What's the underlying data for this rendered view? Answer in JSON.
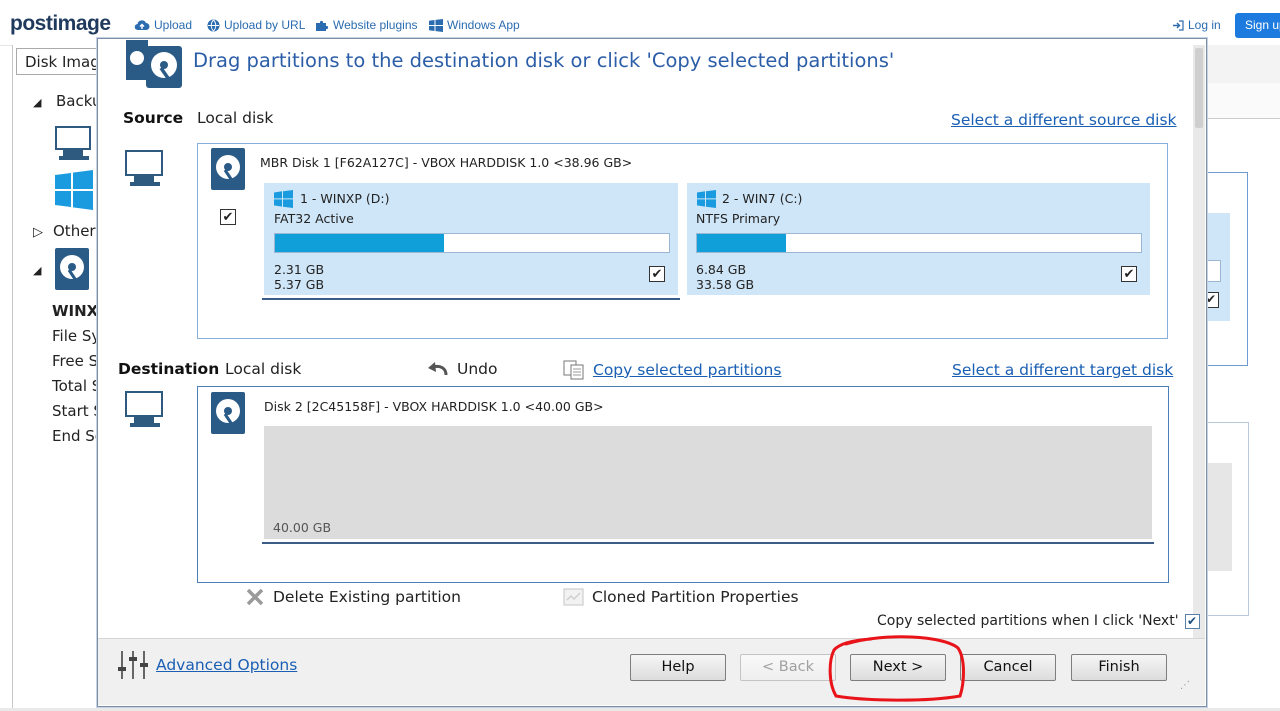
{
  "site": {
    "logo": "postimage",
    "nav": [
      {
        "label": "Upload",
        "icon": "cloud-upload-icon"
      },
      {
        "label": "Upload by URL",
        "icon": "globe-icon"
      },
      {
        "label": "Website plugins",
        "icon": "puzzle-icon"
      },
      {
        "label": "Windows App",
        "icon": "windows-icon"
      }
    ],
    "login": "Log in",
    "signup": "Sign up"
  },
  "background_app": {
    "tab": "Disk Image",
    "tree": [
      "Backu",
      "Other",
      "WINX",
      "File Sy",
      "Free Sp",
      "Total S",
      "Start S",
      "End Se"
    ]
  },
  "dialog": {
    "title": "Drag partitions to the destination disk or click 'Copy selected partitions'",
    "source": {
      "label": "Source",
      "type": "Local disk",
      "change_link": "Select a different source disk",
      "disk_title": "MBR Disk 1 [F62A127C] - VBOX HARDDISK 1.0  <38.96 GB>",
      "partitions": [
        {
          "name": "1 - WINXP (D:)",
          "fs": "FAT32 Active",
          "used": "2.31 GB",
          "total": "5.37 GB",
          "fill": 0.43,
          "checked": true
        },
        {
          "name": "2 - WIN7 (C:)",
          "fs": "NTFS Primary",
          "used": "6.84 GB",
          "total": "33.58 GB",
          "fill": 0.2,
          "checked": true
        }
      ]
    },
    "destination": {
      "label": "Destination",
      "type": "Local disk",
      "undo": "Undo",
      "copy_link": "Copy selected partitions",
      "change_link": "Select a different target disk",
      "disk_title": "Disk 2 [2C45158F] - VBOX HARDDISK 1.0  <40.00 GB>",
      "unallocated": "40.00 GB"
    },
    "actions": {
      "delete": "Delete Existing partition",
      "properties": "Cloned Partition Properties",
      "copy_on_next": "Copy selected partitions when I click 'Next'"
    },
    "footer": {
      "advanced": "Advanced Options",
      "help": "Help",
      "back": "< Back",
      "next": "Next >",
      "cancel": "Cancel",
      "finish": "Finish"
    }
  },
  "colors": {
    "accent": "#2c5ea8",
    "bar_fill": "#109fd8",
    "annotation": "#e8141a"
  }
}
